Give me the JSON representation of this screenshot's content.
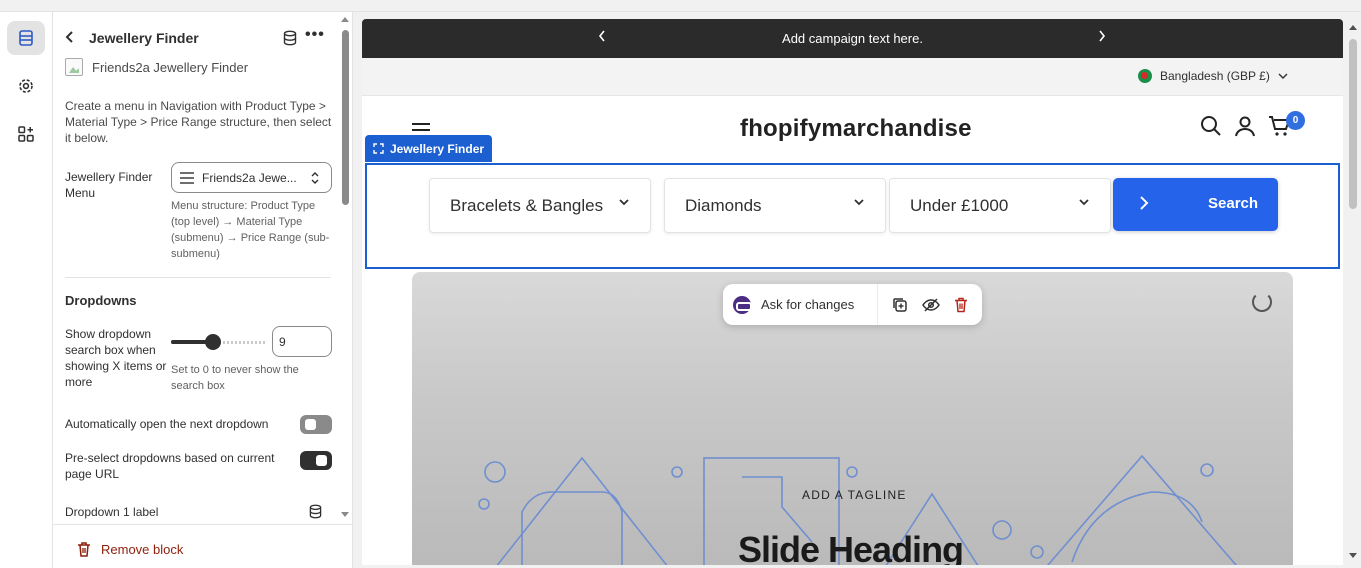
{
  "panel": {
    "title": "Jewellery Finder",
    "subtitle": "Friends2a Jewellery Finder",
    "description": "Create a menu in Navigation with Product Type > Material Type > Price Range structure, then select it below.",
    "menu_label": "Jewellery Finder Menu",
    "menu_value": "Friends2a Jewe...",
    "menu_help": "Menu structure: Product Type (top level) → Material Type (submenu) → Price Range (sub-submenu)",
    "dropdowns_heading": "Dropdowns",
    "search_box_label": "Show dropdown search box when showing X items or more",
    "search_box_value": "9",
    "search_box_slider_value": 9,
    "search_box_help": "Set to 0 to never show the search box",
    "auto_open_label": "Automatically open the next dropdown",
    "auto_open_on": false,
    "preselect_label": "Pre-select dropdowns based on current page URL",
    "preselect_on": true,
    "dropdown1_label": "Dropdown 1 label",
    "remove_label": "Remove block"
  },
  "preview": {
    "announcement": "Add campaign text here.",
    "locale": "Bangladesh (GBP £)",
    "logo": "fhopifymarchandise",
    "cart_count": "0",
    "block_tag": "Jewellery Finder",
    "dropdowns": [
      "Bracelets & Bangles",
      "Diamonds",
      "Under £1000"
    ],
    "search_label": "Search",
    "toolbar_ask": "Ask for changes",
    "tagline": "ADD A TAGLINE",
    "slide_heading": "Slide Heading"
  },
  "colors": {
    "accent": "#2563eb",
    "block_outline": "#1b5fd1",
    "danger": "#8e1f0b"
  }
}
